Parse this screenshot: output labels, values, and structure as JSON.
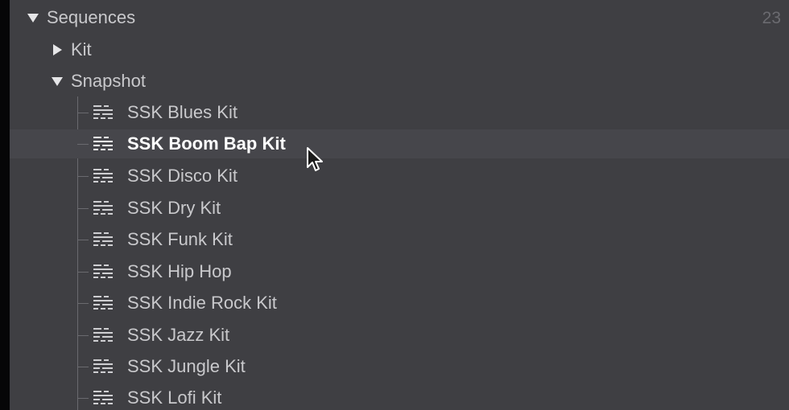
{
  "tree": {
    "root": {
      "label": "Sequences",
      "count": "23",
      "expanded": true
    },
    "children": [
      {
        "label": "Kit",
        "expanded": false
      },
      {
        "label": "Snapshot",
        "expanded": true
      }
    ],
    "snapshot_items": [
      {
        "label": "SSK Blues Kit",
        "icon": "sequence-icon"
      },
      {
        "label": "SSK Boom Bap Kit",
        "icon": "sequence-icon",
        "selected": true
      },
      {
        "label": "SSK Disco Kit",
        "icon": "sequence-icon"
      },
      {
        "label": "SSK Dry Kit",
        "icon": "sequence-icon"
      },
      {
        "label": "SSK Funk Kit",
        "icon": "sequence-icon"
      },
      {
        "label": "SSK Hip Hop",
        "icon": "sequence-icon"
      },
      {
        "label": "SSK Indie Rock Kit",
        "icon": "sequence-icon"
      },
      {
        "label": "SSK Jazz Kit",
        "icon": "sequence-icon"
      },
      {
        "label": "SSK Jungle Kit",
        "icon": "sequence-icon"
      },
      {
        "label": "SSK Lofi Kit",
        "icon": "sequence-icon"
      }
    ]
  },
  "colors": {
    "panel_bg": "#3f3f43",
    "selected_bg": "#46464b",
    "text": "#c9c9cc",
    "text_selected": "#ffffff",
    "count_text": "#6b6b70"
  },
  "pointer": {
    "icon": "mouse-pointer-icon"
  }
}
